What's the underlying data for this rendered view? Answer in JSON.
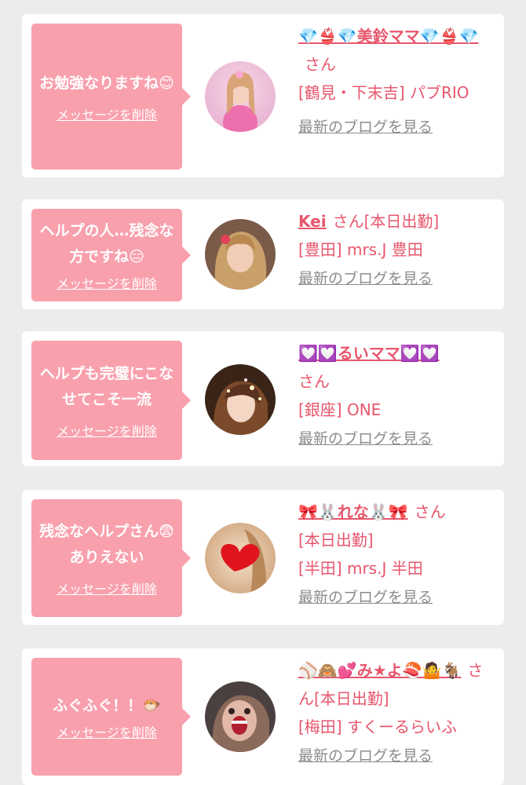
{
  "delete_label": "メッセージを削除",
  "san_label": "さん",
  "blog_label": "最新のブログを見る",
  "colors": {
    "bubble": "#f9a0ad",
    "accent": "#e8566c",
    "link_gray": "#8c8c8c",
    "background": "#ececec"
  },
  "cards": [
    {
      "message": "お勉強なりますね😊",
      "name": "💎👙💎美鈴ママ💎👙💎",
      "status": "",
      "shop": "[鶴見・下末吉] パブRIO",
      "avatar_icon": "avatar-photo-pink"
    },
    {
      "message": "ヘルプの人…残念な方ですね😑",
      "name": "Kei",
      "status": "[本日出勤]",
      "shop": "[豊田] mrs.J 豊田",
      "avatar_icon": "avatar-photo-blonde"
    },
    {
      "message": "ヘルプも完璧にこなせてこそ一流",
      "name": "💟💟るいママ💟💟",
      "status": "",
      "shop": "[銀座] ONE",
      "avatar_icon": "avatar-photo-sparkle"
    },
    {
      "message": "残念なヘルプさん😨ありえない",
      "name": "🎀🐰れな🐰🎀",
      "status": "[本日出勤]",
      "shop": "[半田] mrs.J 半田",
      "avatar_icon": "avatar-photo-heart"
    },
    {
      "message": "ふぐふぐ！！🐡",
      "name": "⚾🙈💕み★よ🍣🤷🐐",
      "status": "[本日出勤]",
      "shop": "[梅田] すくーるらいふ",
      "avatar_icon": "avatar-photo-funny"
    }
  ]
}
